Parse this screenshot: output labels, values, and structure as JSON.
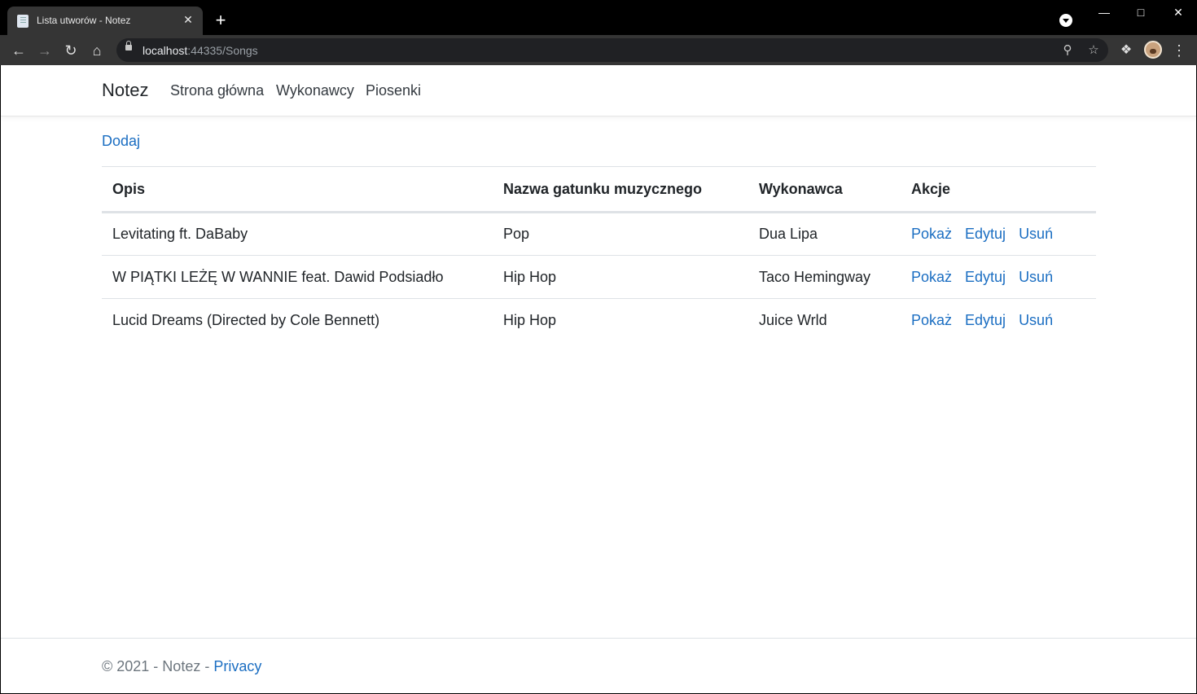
{
  "browser": {
    "tab_title": "Lista utworów - Notez",
    "new_tab_symbol": "+",
    "url_host": "localhost",
    "url_rest": ":44335/Songs"
  },
  "app": {
    "brand": "Notez",
    "nav": [
      "Strona główna",
      "Wykonawcy",
      "Piosenki"
    ]
  },
  "page": {
    "add_label": "Dodaj",
    "columns": [
      "Opis",
      "Nazwa gatunku muzycznego",
      "Wykonawca",
      "Akcje"
    ],
    "rows": [
      {
        "opis": "Levitating ft. DaBaby",
        "gatunek": "Pop",
        "wykonawca": "Dua Lipa"
      },
      {
        "opis": "W PIĄTKI LEŻĘ W WANNIE feat. Dawid Podsiadło",
        "gatunek": "Hip Hop",
        "wykonawca": "Taco Hemingway"
      },
      {
        "opis": "Lucid Dreams (Directed by Cole Bennett)",
        "gatunek": "Hip Hop",
        "wykonawca": "Juice Wrld"
      }
    ],
    "actions": [
      "Pokaż",
      "Edytuj",
      "Usuń"
    ]
  },
  "footer": {
    "text": "© 2021 - Notez - ",
    "privacy_label": "Privacy"
  },
  "colors": {
    "link": "#1b6ec2",
    "text": "#212529",
    "muted": "#6c757d",
    "chrome_bg": "#353535"
  }
}
